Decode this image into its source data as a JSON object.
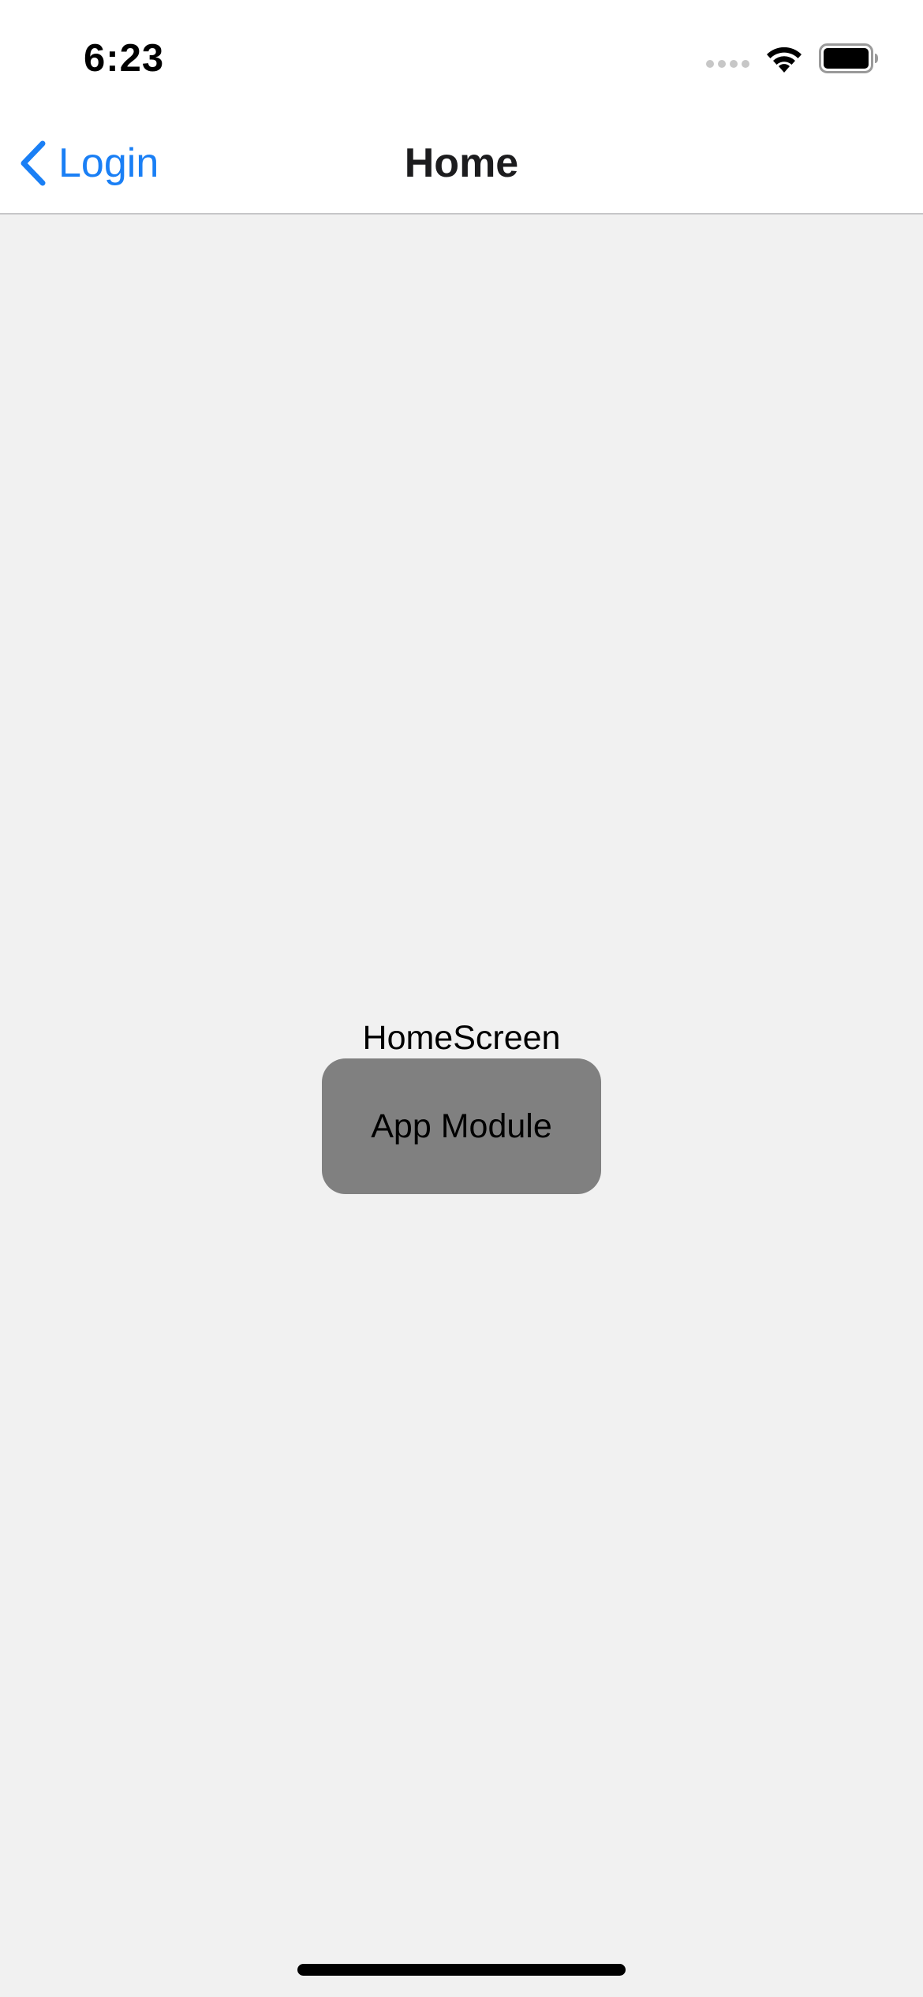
{
  "status_bar": {
    "time": "6:23",
    "signal_icon": "cellular-signal-weak-icon",
    "wifi_icon": "wifi-icon",
    "battery_icon": "battery-full-icon"
  },
  "nav": {
    "back_label": "Login",
    "back_icon": "chevron-left-icon",
    "title": "Home"
  },
  "content": {
    "screen_label": "HomeScreen",
    "button_label": "App Module"
  },
  "colors": {
    "accent": "#1a7ff5",
    "background": "#f1f1f1",
    "button": "#808080",
    "nav_background": "#ffffff"
  }
}
